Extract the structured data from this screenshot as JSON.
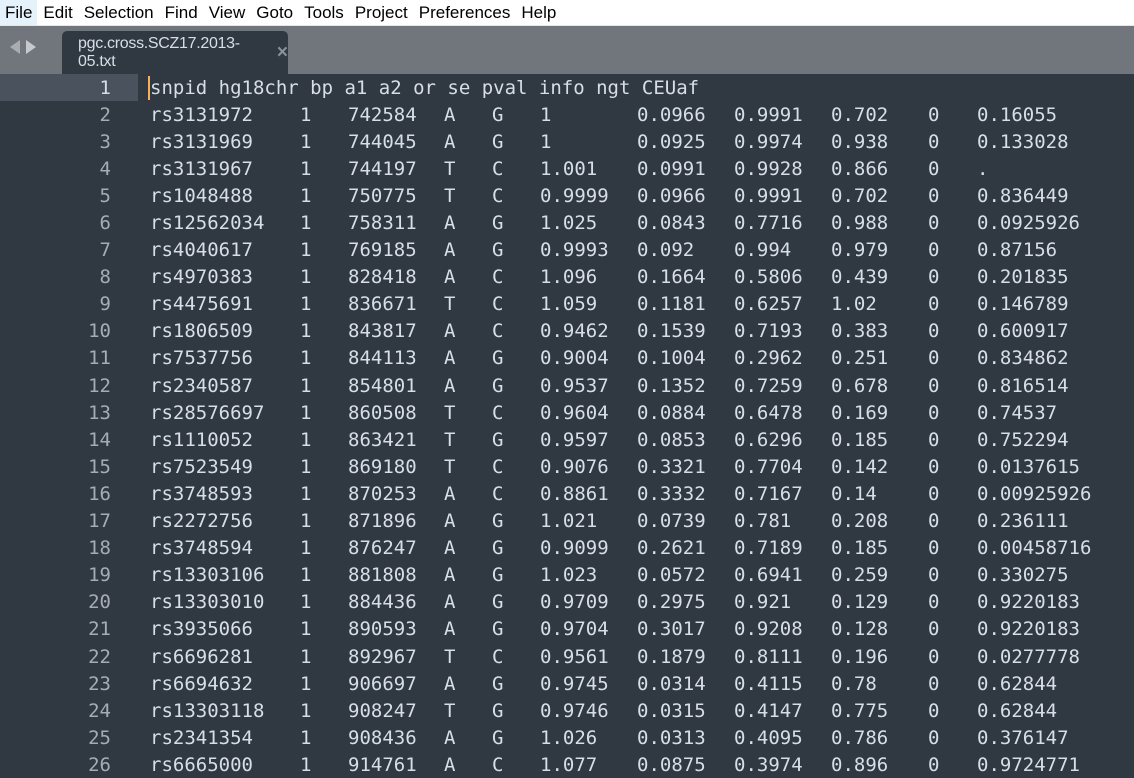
{
  "menu": [
    "File",
    "Edit",
    "Selection",
    "Find",
    "View",
    "Goto",
    "Tools",
    "Project",
    "Preferences",
    "Help"
  ],
  "tab": {
    "title": "pgc.cross.SCZ17.2013-05.txt",
    "close_icon": "×"
  },
  "editor": {
    "header_line": "snpid hg18chr bp a1 a2 or se pval info ngt CEUaf",
    "columns": [
      "snpid",
      "hg18chr",
      "bp",
      "a1",
      "a2",
      "or",
      "se",
      "pval",
      "info",
      "ngt",
      "CEUaf"
    ],
    "rows": [
      [
        "rs3131972",
        "1",
        "742584",
        "A",
        "G",
        "1",
        "0.0966",
        "0.9991",
        "0.702",
        "0",
        "0.16055"
      ],
      [
        "rs3131969",
        "1",
        "744045",
        "A",
        "G",
        "1",
        "0.0925",
        "0.9974",
        "0.938",
        "0",
        "0.133028"
      ],
      [
        "rs3131967",
        "1",
        "744197",
        "T",
        "C",
        "1.001",
        "0.0991",
        "0.9928",
        "0.866",
        "0",
        "."
      ],
      [
        "rs1048488",
        "1",
        "750775",
        "T",
        "C",
        "0.9999",
        "0.0966",
        "0.9991",
        "0.702",
        "0",
        "0.836449"
      ],
      [
        "rs12562034",
        "1",
        "758311",
        "A",
        "G",
        "1.025",
        "0.0843",
        "0.7716",
        "0.988",
        "0",
        "0.0925926"
      ],
      [
        "rs4040617",
        "1",
        "769185",
        "A",
        "G",
        "0.9993",
        "0.092",
        "0.994",
        "0.979",
        "0",
        "0.87156"
      ],
      [
        "rs4970383",
        "1",
        "828418",
        "A",
        "C",
        "1.096",
        "0.1664",
        "0.5806",
        "0.439",
        "0",
        "0.201835"
      ],
      [
        "rs4475691",
        "1",
        "836671",
        "T",
        "C",
        "1.059",
        "0.1181",
        "0.6257",
        "1.02",
        "0",
        "0.146789"
      ],
      [
        "rs1806509",
        "1",
        "843817",
        "A",
        "C",
        "0.9462",
        "0.1539",
        "0.7193",
        "0.383",
        "0",
        "0.600917"
      ],
      [
        "rs7537756",
        "1",
        "844113",
        "A",
        "G",
        "0.9004",
        "0.1004",
        "0.2962",
        "0.251",
        "0",
        "0.834862"
      ],
      [
        "rs2340587",
        "1",
        "854801",
        "A",
        "G",
        "0.9537",
        "0.1352",
        "0.7259",
        "0.678",
        "0",
        "0.816514"
      ],
      [
        "rs28576697",
        "1",
        "860508",
        "T",
        "C",
        "0.9604",
        "0.0884",
        "0.6478",
        "0.169",
        "0",
        "0.74537"
      ],
      [
        "rs1110052",
        "1",
        "863421",
        "T",
        "G",
        "0.9597",
        "0.0853",
        "0.6296",
        "0.185",
        "0",
        "0.752294"
      ],
      [
        "rs7523549",
        "1",
        "869180",
        "T",
        "C",
        "0.9076",
        "0.3321",
        "0.7704",
        "0.142",
        "0",
        "0.0137615"
      ],
      [
        "rs3748593",
        "1",
        "870253",
        "A",
        "C",
        "0.8861",
        "0.3332",
        "0.7167",
        "0.14",
        "0",
        "0.00925926"
      ],
      [
        "rs2272756",
        "1",
        "871896",
        "A",
        "G",
        "1.021",
        "0.0739",
        "0.781",
        "0.208",
        "0",
        "0.236111"
      ],
      [
        "rs3748594",
        "1",
        "876247",
        "A",
        "G",
        "0.9099",
        "0.2621",
        "0.7189",
        "0.185",
        "0",
        "0.00458716"
      ],
      [
        "rs13303106",
        "1",
        "881808",
        "A",
        "G",
        "1.023",
        "0.0572",
        "0.6941",
        "0.259",
        "0",
        "0.330275"
      ],
      [
        "rs13303010",
        "1",
        "884436",
        "A",
        "G",
        "0.9709",
        "0.2975",
        "0.921",
        "0.129",
        "0",
        "0.9220183"
      ],
      [
        "rs3935066",
        "1",
        "890593",
        "A",
        "G",
        "0.9704",
        "0.3017",
        "0.9208",
        "0.128",
        "0",
        "0.9220183"
      ],
      [
        "rs6696281",
        "1",
        "892967",
        "T",
        "C",
        "0.9561",
        "0.1879",
        "0.8111",
        "0.196",
        "0",
        "0.0277778"
      ],
      [
        "rs6694632",
        "1",
        "906697",
        "A",
        "G",
        "0.9745",
        "0.0314",
        "0.4115",
        "0.78",
        "0",
        "0.62844"
      ],
      [
        "rs13303118",
        "1",
        "908247",
        "T",
        "G",
        "0.9746",
        "0.0315",
        "0.4147",
        "0.775",
        "0",
        "0.62844"
      ],
      [
        "rs2341354",
        "1",
        "908436",
        "A",
        "G",
        "1.026",
        "0.0313",
        "0.4095",
        "0.786",
        "0",
        "0.376147"
      ],
      [
        "rs6665000",
        "1",
        "914761",
        "A",
        "C",
        "1.077",
        "0.0875",
        "0.3974",
        "0.896",
        "0",
        "0.9724771"
      ]
    ]
  },
  "colors": {
    "editor_bg": "#303841",
    "tabbar_bg": "#71767d",
    "caret": "#f9ae58",
    "text": "#d8dee9",
    "gutter_text": "#a6acb3"
  }
}
